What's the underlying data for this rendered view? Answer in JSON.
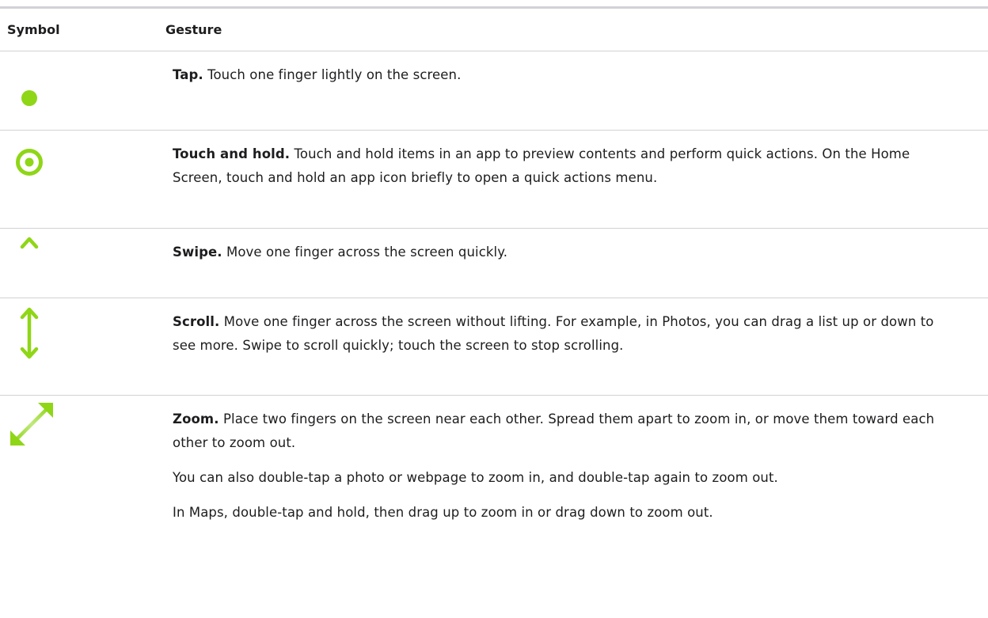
{
  "table": {
    "headers": {
      "symbol": "Symbol",
      "gesture": "Gesture"
    },
    "accent_color": "#8fd616",
    "rows": [
      {
        "icon": "tap-icon",
        "term": "Tap.",
        "paragraphs": [
          "Touch one finger lightly on the screen."
        ]
      },
      {
        "icon": "touch-and-hold-icon",
        "term": "Touch and hold.",
        "paragraphs": [
          "Touch and hold items in an app to preview contents and perform quick actions. On the Home Screen, touch and hold an app icon briefly to open a quick actions menu."
        ]
      },
      {
        "icon": "swipe-up-arrow-icon",
        "term": "Swipe.",
        "paragraphs": [
          "Move one finger across the screen quickly."
        ]
      },
      {
        "icon": "scroll-vertical-arrows-icon",
        "term": "Scroll.",
        "paragraphs": [
          "Move one finger across the screen without lifting. For example, in Photos, you can drag a list up or down to see more. Swipe to scroll quickly; touch the screen to stop scrolling."
        ]
      },
      {
        "icon": "zoom-diagonal-arrows-icon",
        "term": "Zoom.",
        "paragraphs": [
          "Place two fingers on the screen near each other. Spread them apart to zoom in, or move them toward each other to zoom out.",
          "You can also double-tap a photo or webpage to zoom in, and double-tap again to zoom out.",
          "In Maps, double-tap and hold, then drag up to zoom in or drag down to zoom out."
        ]
      }
    ]
  }
}
